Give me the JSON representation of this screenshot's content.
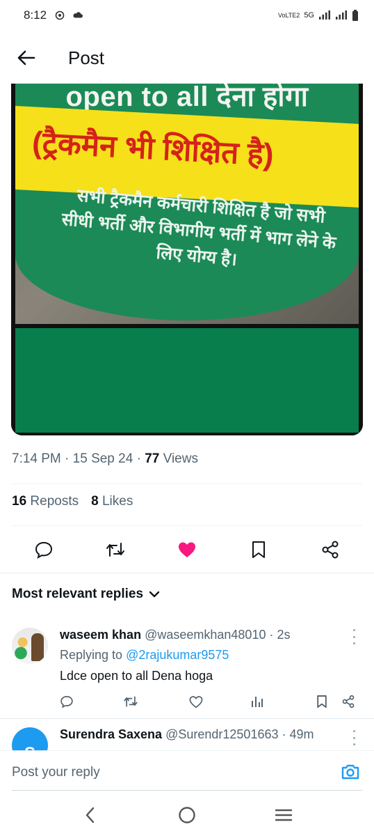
{
  "status_bar": {
    "time": "8:12",
    "network": "5G",
    "volte": "VoLTE2"
  },
  "header": {
    "title": "Post"
  },
  "media": {
    "line1": "open to all देना होगा",
    "band": "(ट्रैकमैन भी शिक्षित है)",
    "body": "सभी ट्रैकमैन कर्मचारी शिक्षित है जो सभी सीधी भर्ती और विभागीय भर्ती में भाग लेने के लिए योग्य है।"
  },
  "post_meta": {
    "time": "7:14 PM",
    "date": "15 Sep 24",
    "views_count": "77",
    "views_label": "Views"
  },
  "stats": {
    "reposts_count": "16",
    "reposts_label": "Reposts",
    "likes_count": "8",
    "likes_label": "Likes"
  },
  "colors": {
    "like": "#f91880",
    "link": "#1d9bf0"
  },
  "replies_header": {
    "label": "Most relevant replies"
  },
  "replies": [
    {
      "name": "waseem khan",
      "handle": "@waseemkhan48010",
      "time": "2s",
      "replying_label": "Replying to",
      "replying_to": "@2rajukumar9575",
      "text": "Ldce open to all Dena hoga"
    },
    {
      "name": "Surendra Saxena",
      "handle": "@Surendr12501663",
      "time": "49m",
      "avatar_letter": "S"
    }
  ],
  "composer": {
    "placeholder": "Post your reply"
  }
}
